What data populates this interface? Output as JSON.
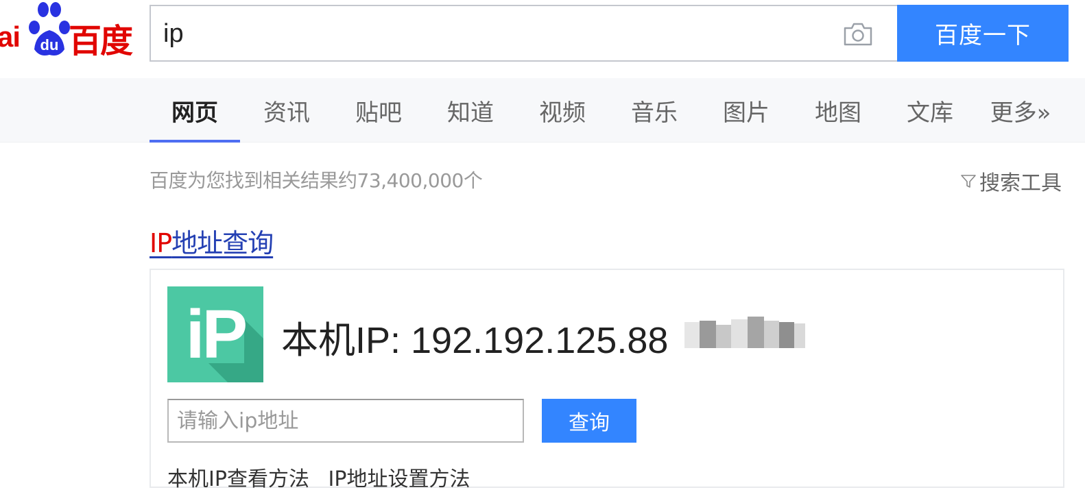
{
  "logo": {
    "ai_text": "ai",
    "du_text": "du",
    "cn_text": "百度"
  },
  "search": {
    "query": "ip",
    "button_label": "百度一下",
    "camera_icon": "camera-icon"
  },
  "tabs": [
    {
      "label": "网页",
      "active": true
    },
    {
      "label": "资讯",
      "active": false
    },
    {
      "label": "贴吧",
      "active": false
    },
    {
      "label": "知道",
      "active": false
    },
    {
      "label": "视频",
      "active": false
    },
    {
      "label": "音乐",
      "active": false
    },
    {
      "label": "图片",
      "active": false
    },
    {
      "label": "地图",
      "active": false
    },
    {
      "label": "文库",
      "active": false
    },
    {
      "label": "更多»",
      "active": false
    }
  ],
  "results_meta": {
    "count_text": "百度为您找到相关结果约73,400,000个",
    "tools_label": "搜索工具"
  },
  "result": {
    "title_highlight": "IP",
    "title_rest": "地址查询",
    "logo_text": "iP",
    "ip_line": "本机IP: 192.192.125.88",
    "query_placeholder": "请输入ip地址",
    "query_button": "查询",
    "link_1": "本机IP查看方法",
    "link_2": "IP地址设置方法"
  },
  "colors": {
    "brand_red": "#e10602",
    "button_blue": "#3385ff",
    "tab_underline": "#4e6ef2",
    "link_blue": "#2440b3",
    "ip_logo_green": "#4cc8a3"
  }
}
